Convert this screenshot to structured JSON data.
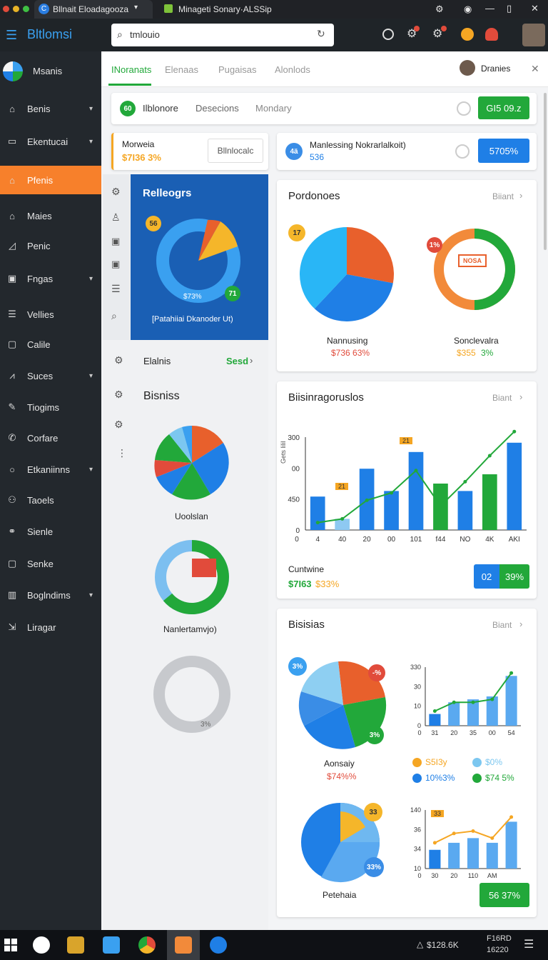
{
  "window": {
    "tab1_title": "Bllnait Eloadagooza",
    "tab2_title": "Minageti Sonary·ALSSip"
  },
  "topbar": {
    "app_name": "Bltlomsi",
    "search_value": "tmlouio"
  },
  "sidebar": {
    "header": "Msanis",
    "items": [
      {
        "label": "Benis",
        "icon": "home-icon",
        "chev": true
      },
      {
        "label": "Ekentucai",
        "icon": "monitor-icon",
        "chev": true
      },
      {
        "label": "Pfenis",
        "icon": "home-icon",
        "chev": false
      },
      {
        "label": "Maies",
        "icon": "home-icon",
        "chev": false
      },
      {
        "label": "Penic",
        "icon": "chart-icon",
        "chev": false
      },
      {
        "label": "Fngas",
        "icon": "card-icon",
        "chev": true
      },
      {
        "label": "Vellies",
        "icon": "list-icon",
        "chev": false
      },
      {
        "label": "Calile",
        "icon": "file-icon",
        "chev": false
      },
      {
        "label": "Suces",
        "icon": "signal-icon",
        "chev": true
      },
      {
        "label": "Tiogims",
        "icon": "pen-icon",
        "chev": false
      },
      {
        "label": "Corfare",
        "icon": "phone-icon",
        "chev": false
      },
      {
        "label": "Etkaniinns",
        "icon": "circle-icon",
        "chev": true
      },
      {
        "label": "Taoels",
        "icon": "users-icon",
        "chev": false
      },
      {
        "label": "Sienle",
        "icon": "link-icon",
        "chev": false
      },
      {
        "label": "Senke",
        "icon": "square-icon",
        "chev": false
      },
      {
        "label": "Boglndims",
        "icon": "table-icon",
        "chev": true
      },
      {
        "label": "Liragar",
        "icon": "export-icon",
        "chev": false
      }
    ]
  },
  "tabs": [
    "INoranats",
    "Elenaas",
    "Pugaisas",
    "Alonlods"
  ],
  "user": {
    "name": "Dranies",
    "close": "✕"
  },
  "filter_bar": {
    "badge": "60",
    "label1": "Ilblonore",
    "label2": "Desecions",
    "label3": "Mondary",
    "button": "GI5 09.z"
  },
  "stat_left": {
    "title": "Morweia",
    "value": "$7I36 3%",
    "button": "Bllnlocalc"
  },
  "stat_right": {
    "badge": "4ä",
    "title": "Manlessing Nokrarlalkoit)",
    "value": "536",
    "button": "5705%"
  },
  "blue_panel": {
    "title": "Relleogrs",
    "badge_top": "56",
    "badge_bottom": "71",
    "pct": "$73%",
    "caption": "[Patahiiai Dkanoder Ut)"
  },
  "left_col": {
    "row_label": "Elalnis",
    "row_link": "Sesd",
    "section_title": "Bisniss",
    "pie1_caption": "Uoolslan",
    "pie2_caption": "Nanlertamvjo)",
    "ring_label": "3%"
  },
  "card_podonoes": {
    "title": "Pordonoes",
    "link": "Biiant",
    "badge1": "17",
    "badge2": "1%",
    "ring_label": "NOSA",
    "cap1": "Nannusing",
    "val1": "$736 63%",
    "cap2": "Sonclevalra",
    "val2a": "$355",
    "val2b": "3%"
  },
  "card_bar": {
    "title": "Biisinragoruslos",
    "link": "Biant",
    "ylabels": [
      "300",
      "00",
      "450",
      "0"
    ],
    "ytitle": "Gets lilil",
    "xlabels": [
      "0",
      "4",
      "40",
      "20",
      "00",
      "101",
      "f44",
      "NO",
      "4K",
      "AKI"
    ],
    "tag1": "21",
    "tag2": "21",
    "footer_title": "Cuntwine",
    "footer_value_a": "$7I63",
    "footer_value_b": "$33%",
    "btn_a": "02",
    "btn_b": "39%"
  },
  "card_bisisias": {
    "title": "Bisisias",
    "link": "Biant",
    "badge1": "3%",
    "badge2": "-%",
    "badge3": "3%",
    "pie_caption": "Aonsaiy",
    "pie_value": "$74%%",
    "legend": [
      {
        "label": "S5I3y",
        "color": "#f5a623"
      },
      {
        "label": "$0%",
        "color": "#7cc7f0"
      },
      {
        "label": "10%3%",
        "color": "#1f7fe6"
      },
      {
        "label": "$74 5%",
        "color": "#22a83a"
      }
    ],
    "bar1_y": [
      "330",
      "30",
      "10",
      "0"
    ],
    "bar1_x": [
      "0",
      "31",
      "20",
      "35",
      "00",
      "54"
    ],
    "pie2_badge1": "33",
    "pie2_badge2": "33%",
    "pie2_caption": "Petehaia",
    "bar2_tag": "33",
    "bar2_y": [
      "140",
      "36",
      "34",
      "10"
    ],
    "bar2_x": [
      "0",
      "30",
      "20",
      "110",
      "AM"
    ],
    "button": "56 37%"
  },
  "taskbar": {
    "tray_text": "$128.6K",
    "time1": "F16RD",
    "time2": "16220"
  },
  "chart_data": [
    {
      "type": "pie",
      "title": "Pordonoes",
      "labels": [
        "",
        "",
        ""
      ],
      "values": [
        28,
        34,
        38
      ],
      "colors": [
        "#e8602c",
        "#1f7fe6",
        "#29b6f6"
      ]
    },
    {
      "type": "bar",
      "title": "Biisinragoruslos",
      "categories": [
        "4",
        "40",
        "20",
        "00",
        "101",
        "f44",
        "NO",
        "4K",
        "AKI"
      ],
      "series": [
        {
          "values": [
            180,
            60,
            330,
            210,
            420,
            250,
            210,
            300,
            470
          ]
        },
        {
          "values": [
            40,
            60,
            160,
            200,
            320,
            130,
            260,
            400,
            530
          ]
        }
      ],
      "ylim": [
        0,
        500
      ]
    },
    {
      "type": "bar",
      "categories": [
        "31",
        "20",
        "35",
        "00",
        "54",
        ""
      ],
      "series": [
        {
          "values": [
            8,
            16,
            18,
            20,
            34
          ]
        },
        {
          "values": [
            10,
            16,
            16,
            18,
            36
          ]
        }
      ],
      "ylim": [
        0,
        40
      ]
    },
    {
      "type": "bar",
      "categories": [
        "30",
        "20",
        "110",
        "",
        "AM",
        ""
      ],
      "series": [
        {
          "values": [
            16,
            22,
            26,
            22,
            40
          ]
        },
        {
          "values": [
            22,
            30,
            32,
            26,
            44
          ]
        }
      ],
      "ylim": [
        0,
        50
      ]
    }
  ]
}
